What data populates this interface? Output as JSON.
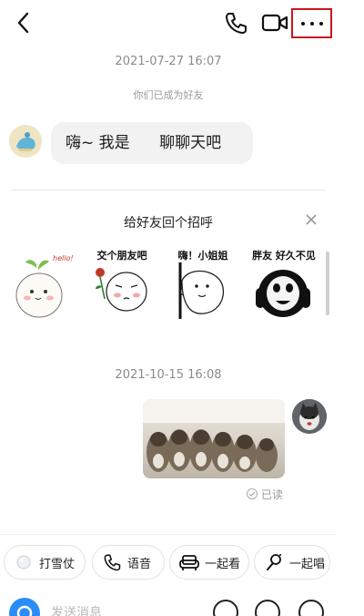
{
  "header": {
    "back_icon": "chevron-left-icon",
    "call_icon": "phone-icon",
    "video_icon": "video-camera-icon",
    "more_icon": "more-dots-icon",
    "highlight_color": "#c8161d"
  },
  "chat": {
    "timestamp_1": "2021-07-27 16:07",
    "system_notice": "你们已成为好友",
    "message_1": "嗨~ 我是      聊聊天吧",
    "timestamp_2": "2021-10-15 16:08",
    "read_status": "已读"
  },
  "greeting_panel": {
    "title": "给好友回个招呼",
    "close_icon": "close-icon",
    "stickers": [
      {
        "caption": "hello!",
        "icon": "sprout-hello-sticker"
      },
      {
        "caption": "交个朋友吧",
        "icon": "rose-face-sticker"
      },
      {
        "caption": "嗨！小姐姐",
        "icon": "peek-face-sticker"
      },
      {
        "caption": "胖友 好久不见",
        "icon": "panda-face-sticker"
      }
    ]
  },
  "quick_actions": [
    {
      "label": "打雪仗",
      "icon": "snowball-icon"
    },
    {
      "label": "语音",
      "icon": "phone-icon"
    },
    {
      "label": "一起看",
      "icon": "sofa-icon"
    },
    {
      "label": "一起唱",
      "icon": "microphone-icon"
    }
  ],
  "input": {
    "placeholder": "发送消息",
    "voice_icon": "voice-wave-icon",
    "emoji_icon": "emoji-icon",
    "add_icon": "plus-icon",
    "accent_color": "#2a8cf6"
  }
}
